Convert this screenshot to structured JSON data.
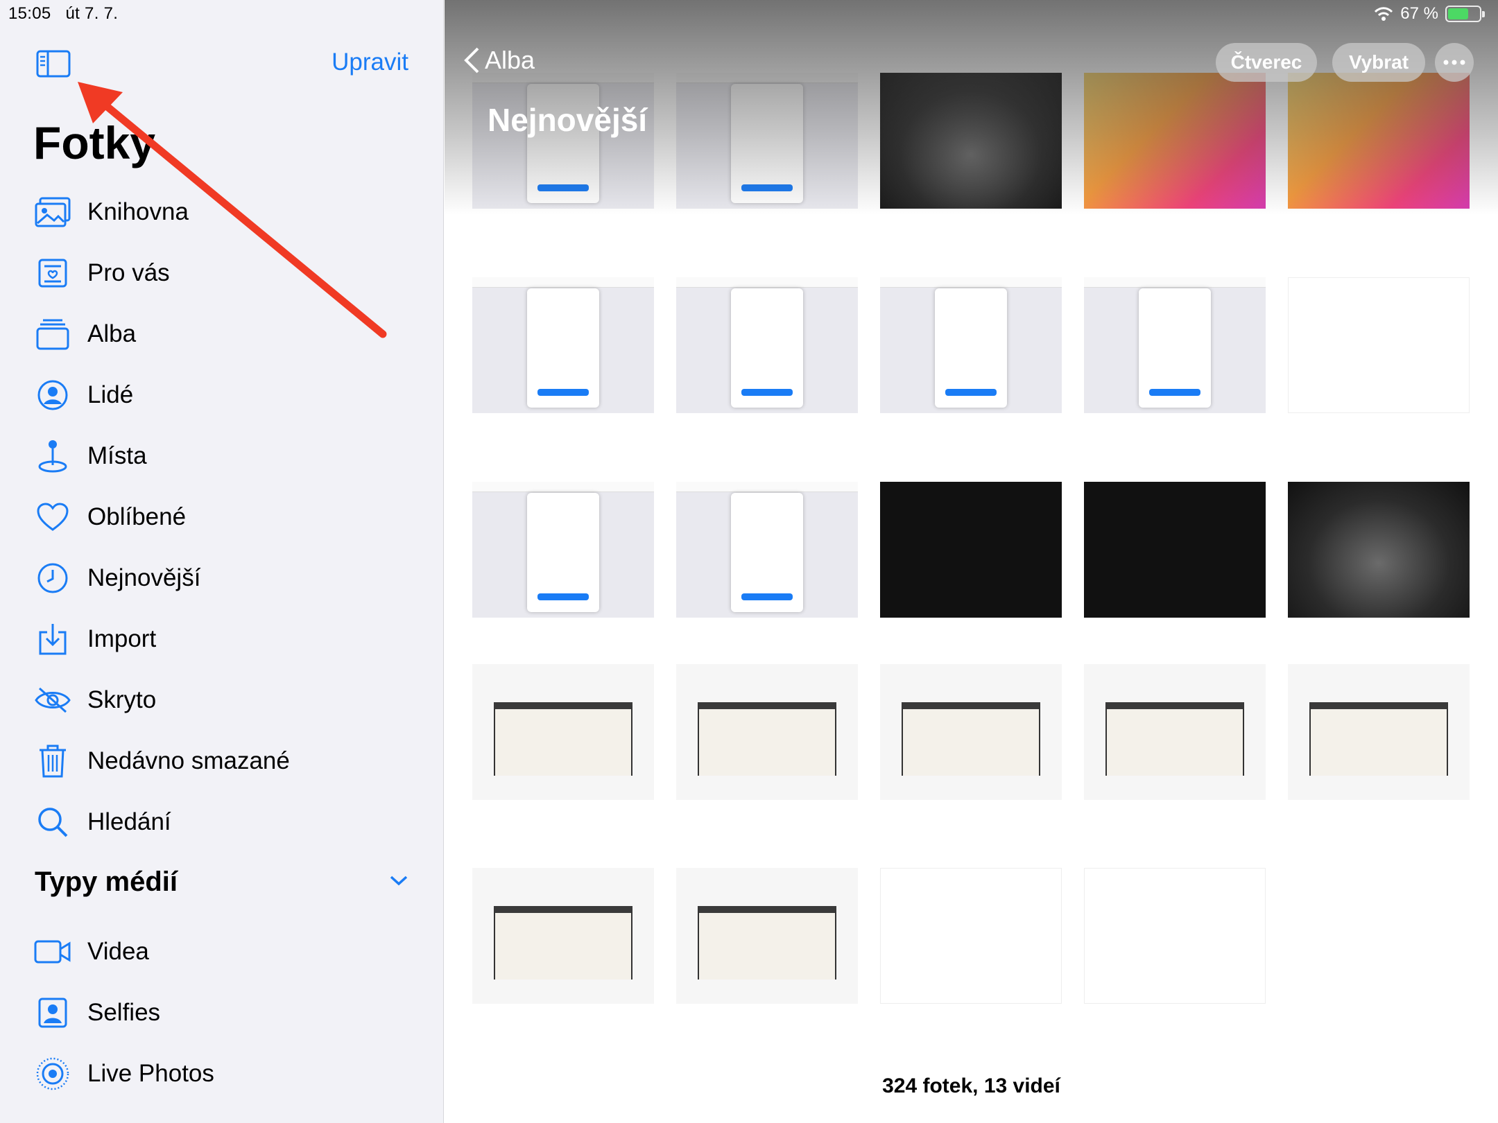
{
  "status_bar": {
    "time": "15:05",
    "date": "út 7. 7.",
    "battery_text": "67 %",
    "battery_level": 0.67,
    "battery_color": "#4cd964"
  },
  "sidebar": {
    "edit_label": "Upravit",
    "title": "Fotky",
    "items": [
      {
        "label": "Knihovna",
        "icon": "photo-library-icon"
      },
      {
        "label": "Pro vás",
        "icon": "for-you-icon"
      },
      {
        "label": "Alba",
        "icon": "albums-icon"
      },
      {
        "label": "Lidé",
        "icon": "people-icon"
      },
      {
        "label": "Místa",
        "icon": "places-pin-icon"
      },
      {
        "label": "Oblíbené",
        "icon": "heart-icon"
      },
      {
        "label": "Nejnovější",
        "icon": "clock-icon"
      },
      {
        "label": "Import",
        "icon": "import-icon"
      },
      {
        "label": "Skryto",
        "icon": "hidden-eye-icon"
      },
      {
        "label": "Nedávno smazané",
        "icon": "trash-icon"
      },
      {
        "label": "Hledání",
        "icon": "search-icon"
      }
    ],
    "media_section": {
      "title": "Typy médií",
      "items": [
        {
          "label": "Videa",
          "icon": "video-icon"
        },
        {
          "label": "Selfies",
          "icon": "selfie-icon"
        },
        {
          "label": "Live Photos",
          "icon": "live-photo-icon"
        }
      ]
    },
    "accent_color": "#1a7cf5"
  },
  "main": {
    "back_label": "Alba",
    "album_title": "Nejnovější",
    "buttons": {
      "square": "Čtverec",
      "select": "Vybrat"
    },
    "footer": "324 fotek, 13 videí",
    "thumbnails": [
      {
        "kind": "web"
      },
      {
        "kind": "web"
      },
      {
        "kind": "dark"
      },
      {
        "kind": "orange"
      },
      {
        "kind": "orange"
      },
      {
        "kind": "web"
      },
      {
        "kind": "web"
      },
      {
        "kind": "web"
      },
      {
        "kind": "web"
      },
      {
        "kind": "settings"
      },
      {
        "kind": "web"
      },
      {
        "kind": "web"
      },
      {
        "kind": "black"
      },
      {
        "kind": "black"
      },
      {
        "kind": "dark"
      },
      {
        "kind": "music"
      },
      {
        "kind": "music"
      },
      {
        "kind": "music"
      },
      {
        "kind": "music"
      },
      {
        "kind": "music"
      },
      {
        "kind": "music"
      },
      {
        "kind": "music"
      },
      {
        "kind": "settings"
      },
      {
        "kind": "settings"
      }
    ]
  },
  "annotation": {
    "arrow_color": "#f03a24"
  }
}
